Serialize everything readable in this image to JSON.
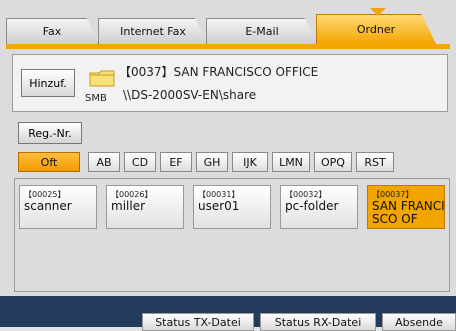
{
  "tabs": [
    {
      "label": "Fax"
    },
    {
      "label": "Internet Fax"
    },
    {
      "label": "E-Mail"
    },
    {
      "label": "Ordner"
    }
  ],
  "colors": {
    "accent": "#f4a500",
    "accent_dark": "#c27b00",
    "panel": "#f2f2f2",
    "bottom_bar": "#233b5c"
  },
  "destination_panel": {
    "add_label": "Hinzuf.",
    "protocol": "SMB",
    "title": "【0037】SAN FRANCISCO OFFICE",
    "path": "\\\\DS-2000SV-EN\\share",
    "icon": "folder-icon"
  },
  "reg_button_label": "Reg.-Nr.",
  "index_tabs": [
    {
      "label": "Oft",
      "active": true
    },
    {
      "label": "AB"
    },
    {
      "label": "CD"
    },
    {
      "label": "EF"
    },
    {
      "label": "GH"
    },
    {
      "label": "IJK"
    },
    {
      "label": "LMN"
    },
    {
      "label": "OPQ"
    },
    {
      "label": "RST"
    }
  ],
  "destinations": [
    {
      "code": "【00025】",
      "name": "scanner"
    },
    {
      "code": "【00026】",
      "name": "miller"
    },
    {
      "code": "【00031】",
      "name": "user01"
    },
    {
      "code": "【00032】",
      "name": "pc-folder"
    },
    {
      "code": "【00037】",
      "name": "SAN FRANCI\nSCO OF",
      "selected": true
    }
  ],
  "bottom_buttons": [
    {
      "label": "Status TX-Datei"
    },
    {
      "label": "Status RX-Datei"
    },
    {
      "label": "Absende"
    }
  ]
}
